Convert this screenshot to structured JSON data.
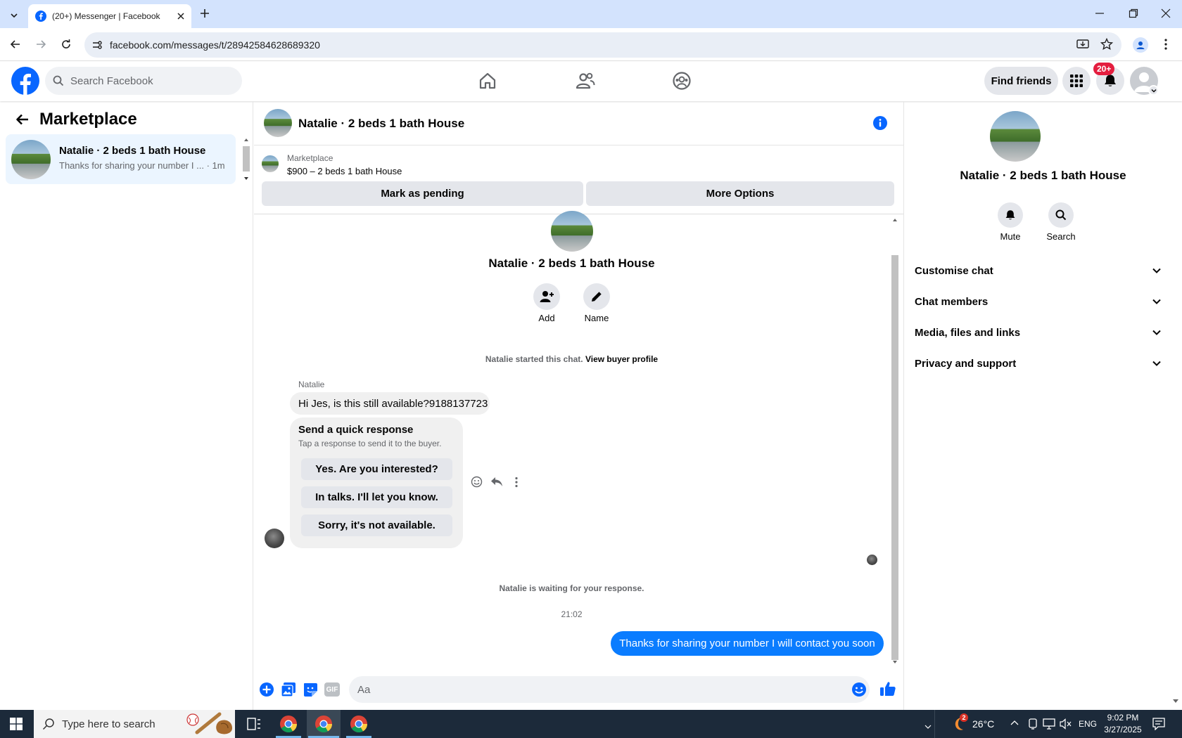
{
  "browser": {
    "tab_title": "(20+) Messenger | Facebook",
    "url": "facebook.com/messages/t/28942584628689320"
  },
  "fb": {
    "search_placeholder": "Search Facebook",
    "find_friends": "Find friends",
    "notif_count": "20+"
  },
  "left": {
    "title": "Marketplace",
    "chat": {
      "name": "Natalie · 2 beds 1 bath House",
      "preview": "Thanks for sharing your number I ...",
      "time": "· 1m"
    }
  },
  "header": {
    "title": "Natalie · 2 beds 1 bath House"
  },
  "listing": {
    "label": "Marketplace",
    "detail": "$900 – 2 beds 1 bath House",
    "mark_pending": "Mark as pending",
    "more_options": "More Options"
  },
  "thread": {
    "name": "Natalie · 2 beds 1 bath House",
    "add_label": "Add",
    "name_label": "Name",
    "started_text": "Natalie started this chat.",
    "view_profile": "View buyer profile",
    "sender": "Natalie",
    "message": "Hi Jes, is this still available?9188137723",
    "qr_title": "Send a quick response",
    "qr_subtitle": "Tap a response to send it to the buyer.",
    "qr_options": [
      "Yes. Are you interested?",
      "In talks. I'll let you know.",
      "Sorry, it's not available."
    ],
    "waiting": "Natalie is waiting for your response.",
    "timestamp": "21:02",
    "outgoing": "Thanks for sharing your number I will contact you soon"
  },
  "composer": {
    "placeholder": "Aa"
  },
  "right": {
    "name": "Natalie · 2 beds 1 bath House",
    "mute": "Mute",
    "search": "Search",
    "sections": [
      "Customise chat",
      "Chat members",
      "Media, files and links",
      "Privacy and support"
    ]
  },
  "taskbar": {
    "search_placeholder": "Type here to search",
    "weather": "26°C",
    "weather_badge": "2",
    "lang": "ENG",
    "time": "9:02 PM",
    "date": "3/27/2025"
  },
  "colors": {
    "fb_blue": "#0866ff",
    "message_blue": "#0a7cff",
    "badge_red": "#e41e3f"
  }
}
